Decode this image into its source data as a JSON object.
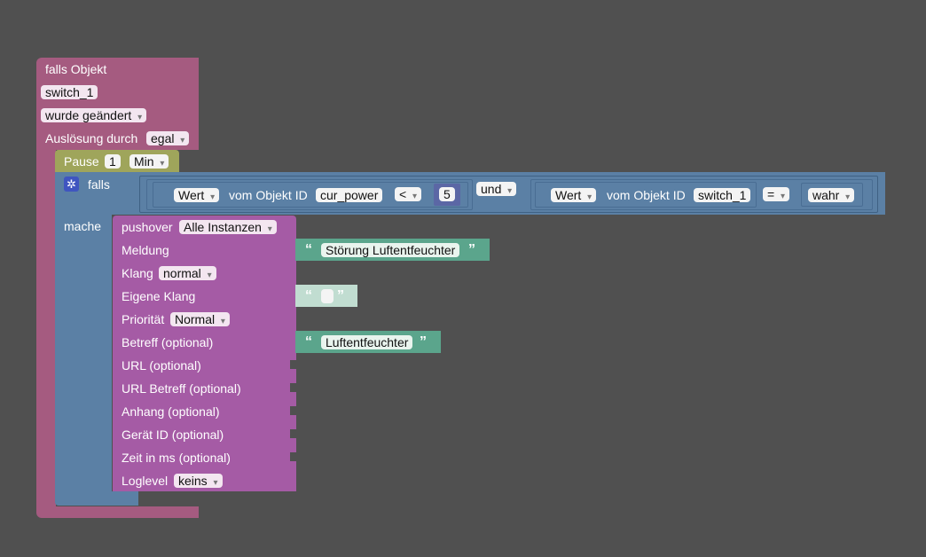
{
  "trigger": {
    "title": "falls Objekt",
    "object_id": "switch_1",
    "change_option": "wurde geändert",
    "trigger_by_label": "Auslösung durch",
    "trigger_by_value": "egal"
  },
  "pause": {
    "label": "Pause",
    "amount": "1",
    "unit": "Min"
  },
  "if_block": {
    "if_label": "falls",
    "do_label": "mache",
    "cond1": {
      "attr": "Wert",
      "from_label": "vom Objekt ID",
      "object_id": "cur_power",
      "operator": "<",
      "number": "5"
    },
    "logic_op": "und",
    "cond2": {
      "attr": "Wert",
      "from_label": "vom Objekt ID",
      "object_id": "switch_1",
      "operator": "=",
      "value": "wahr"
    }
  },
  "pushover": {
    "label": "pushover",
    "instance": "Alle Instanzen",
    "message_label": "Meldung",
    "message_value": "Störung Luftentfeuchter",
    "sound_label": "Klang",
    "sound_value": "normal",
    "own_sound_label": "Eigene Klang",
    "own_sound_value": "",
    "priority_label": "Priorität",
    "priority_value": "Normal",
    "subject_label": "Betreff (optional)",
    "subject_value": "Luftentfeuchter",
    "url_label": "URL (optional)",
    "url_title_label": "URL Betreff (optional)",
    "attachment_label": "Anhang (optional)",
    "device_label": "Gerät ID (optional)",
    "time_label": "Zeit in ms (optional)",
    "loglevel_label": "Loglevel",
    "loglevel_value": "keins"
  },
  "colors": {
    "workspace": "#505050",
    "trigger": "#a55b80",
    "pause": "#9fa55b",
    "logic": "#5b80a5",
    "pushover": "#a55ba5",
    "text": "#5ba58c"
  },
  "icons": {
    "if_gear": "gear-icon",
    "quote_open": "“",
    "quote_close": "”"
  }
}
